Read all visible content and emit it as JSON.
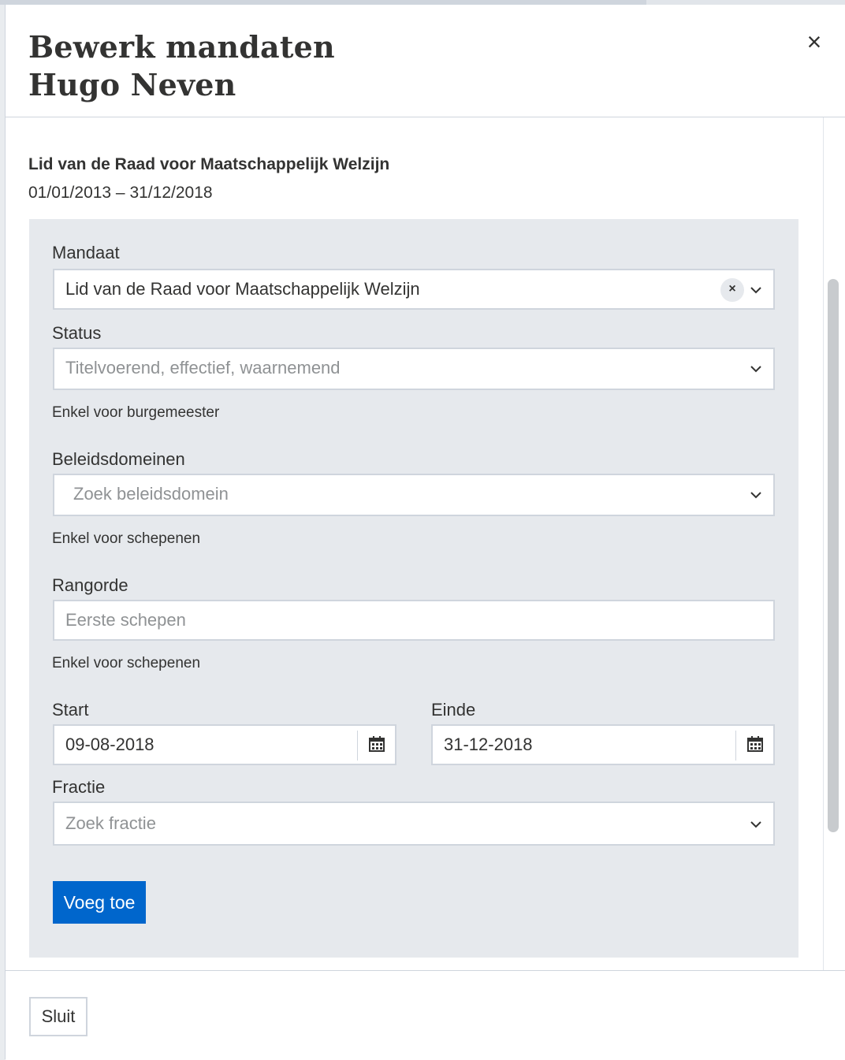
{
  "modal": {
    "title_line1": "Bewerk mandaten",
    "title_line2": "Hugo Neven",
    "close_icon": "close-icon"
  },
  "mandate": {
    "name": "Lid van de Raad voor Maatschappelijk Welzijn",
    "period": "01/01/2013 – 31/12/2018"
  },
  "form": {
    "mandaat": {
      "label": "Mandaat",
      "value": "Lid van de Raad voor Maatschappelijk Welzijn",
      "clear_symbol": "×"
    },
    "status": {
      "label": "Status",
      "placeholder": "Titelvoerend, effectief, waarnemend",
      "hint": "Enkel voor burgemeester"
    },
    "beleidsdomeinen": {
      "label": "Beleidsdomeinen",
      "placeholder": "Zoek beleidsdomein",
      "hint": "Enkel voor schepenen"
    },
    "rangorde": {
      "label": "Rangorde",
      "placeholder": "Eerste schepen",
      "hint": "Enkel voor schepenen"
    },
    "start": {
      "label": "Start",
      "value": "09-08-2018"
    },
    "einde": {
      "label": "Einde",
      "value": "31-12-2018"
    },
    "fractie": {
      "label": "Fractie",
      "placeholder": "Zoek fractie"
    },
    "submit_label": "Voeg toe"
  },
  "footer": {
    "close_label": "Sluit"
  },
  "colors": {
    "primary": "#0066cc",
    "panel": "#e6e9ed",
    "border": "#cfd5dd",
    "text": "#333332",
    "placeholder": "#8f9294"
  }
}
